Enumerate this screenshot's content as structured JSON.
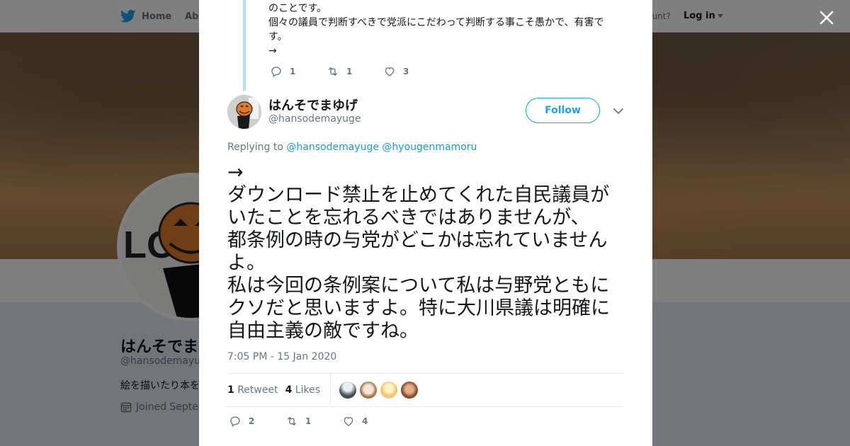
{
  "nav": {
    "home_label": "Home",
    "about_label": "Abo",
    "account_text": "ccount?",
    "login_label": "Log in"
  },
  "profile": {
    "name": "はんそでま",
    "handle": "@hansodemayuge",
    "bio": "絵を描いたり本を",
    "joined": "Joined Septen"
  },
  "previous_tweet": {
    "lines": [
      "のことです。",
      "個々の議員で判断すべきで党派にこだわって判断する事こそ愚かで、有害で",
      "す。",
      "→"
    ],
    "replies": "1",
    "retweets": "1",
    "likes": "3"
  },
  "tweet": {
    "author_name": "はんそでまゆげ",
    "author_handle": "@hansodemayuge",
    "follow_label": "Follow",
    "replying_prefix": "Replying to",
    "replying_to": [
      "@hansodemayuge",
      "@hyougenmamoru"
    ],
    "lines": [
      "→",
      "ダウンロード禁止を止めてくれた自民議員が",
      "いたことを忘れるべきではありませんが、",
      "都条例の時の与党がどこかは忘れていません",
      "よ。",
      "私は今回の条例案について私は与野党ともに",
      "クソだと思いますよ。特に大川県議は明確に",
      "自由主義の敵ですね。"
    ],
    "timestamp": "7:05 PM - 15 Jan 2020",
    "retweet_count": "1",
    "retweet_label": "Retweet",
    "like_count": "4",
    "like_label": "Likes",
    "actions": {
      "replies": "2",
      "retweets": "1",
      "likes": "4"
    }
  },
  "colors": {
    "accent": "#1da1f2",
    "link": "#1b95e0",
    "muted": "#657786",
    "text": "#14171a",
    "thread_line": "#b3dffc"
  }
}
